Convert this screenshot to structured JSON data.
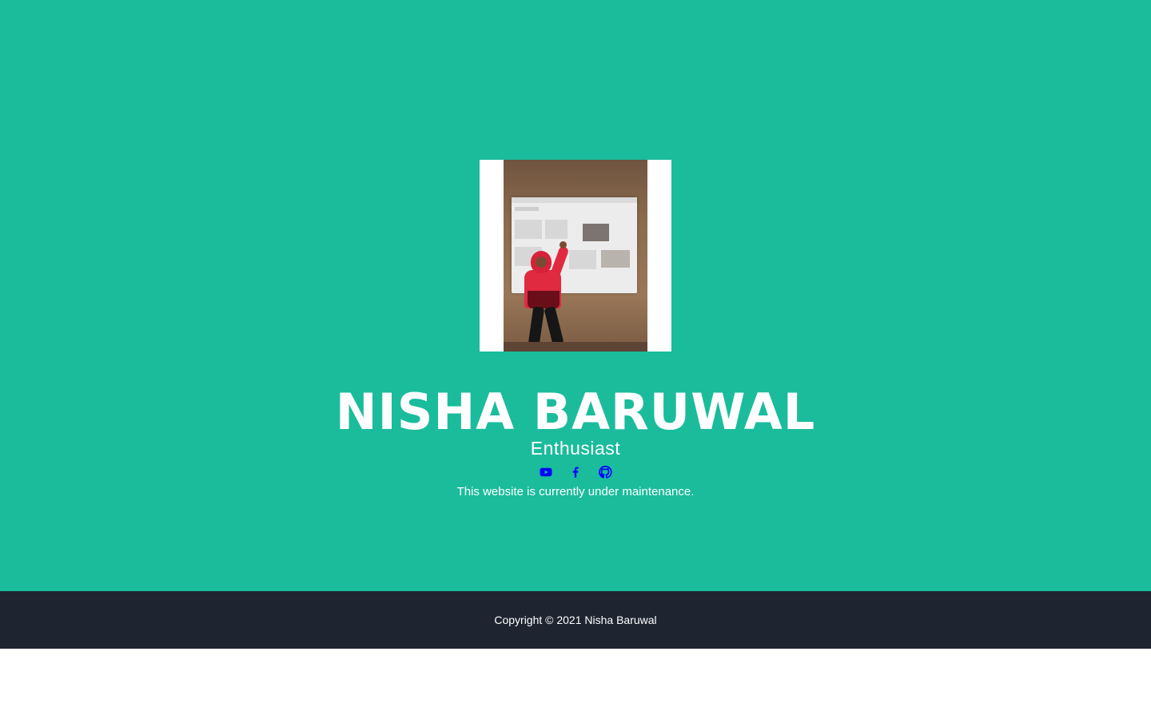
{
  "profile": {
    "name": "NISHA BARUWAL",
    "role": "Enthusiast",
    "notice": "This website is currently under maintenance."
  },
  "social": [
    {
      "icon": "youtube-icon"
    },
    {
      "icon": "facebook-icon"
    },
    {
      "icon": "github-icon"
    }
  ],
  "footer": {
    "copyright": "Copyright © 2021 Nisha Baruwal"
  },
  "colors": {
    "masthead": "#1abc9c",
    "footer": "#1e2430",
    "social_icon": "#0000ff",
    "text": "#ffffff"
  }
}
